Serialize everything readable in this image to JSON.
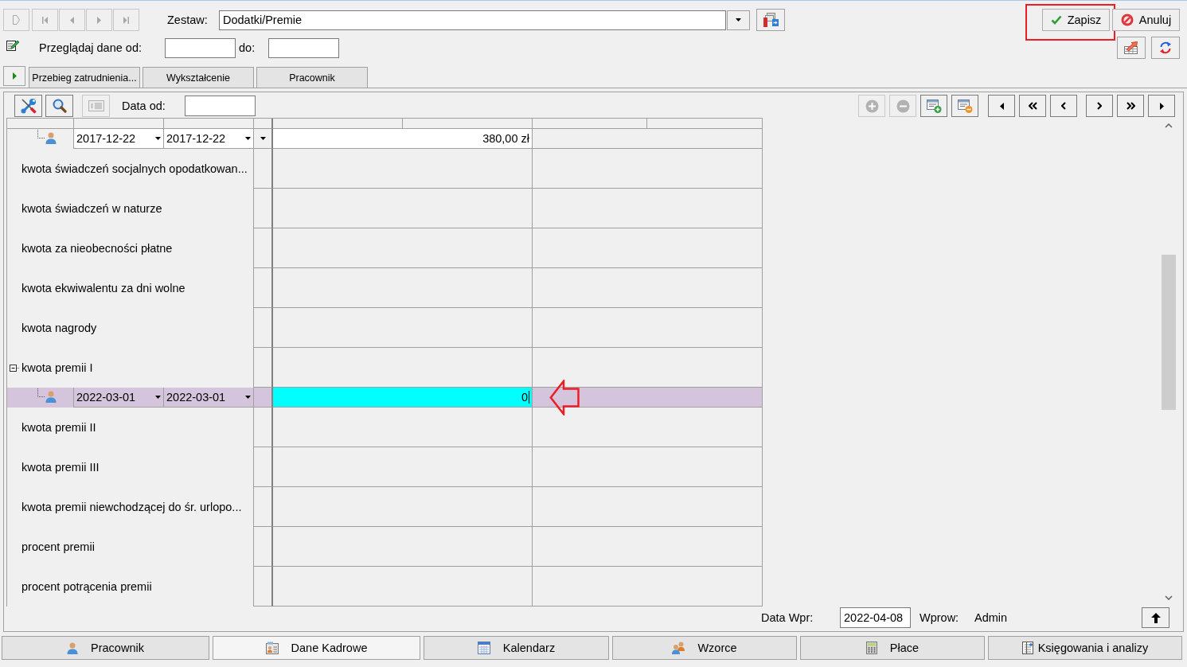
{
  "record_nav": [
    {
      "kind": "new",
      "disabled": true
    },
    {
      "kind": "first",
      "disabled": true
    },
    {
      "kind": "previous",
      "disabled": true
    },
    {
      "kind": "next",
      "disabled": true
    },
    {
      "kind": "last",
      "disabled": true
    }
  ],
  "set": {
    "label": "Zestaw:",
    "value": "Dodatki/Premie"
  },
  "actions": [
    {
      "kind": "save",
      "label": "Zapisz",
      "highlighted": true
    },
    {
      "kind": "cancel",
      "label": "Anuluj",
      "highlighted": false
    }
  ],
  "range": {
    "from_label": "Przeglądaj dane od:",
    "to_label": "do:"
  },
  "tabs": [
    {
      "label": "Przebieg zatrudnienia...",
      "selected": false
    },
    {
      "label": "Wykształcenie",
      "selected": false
    },
    {
      "label": "Pracownik",
      "selected": false
    }
  ],
  "grid_toolbar": {
    "tools": [
      {
        "kind": "settings",
        "disabled": false
      },
      {
        "kind": "search",
        "disabled": false
      },
      {
        "kind": "card",
        "disabled": true
      }
    ],
    "date_label": "Data od:",
    "row_tools": [
      {
        "kind": "add",
        "disabled": true
      },
      {
        "kind": "remove",
        "disabled": true
      },
      {
        "kind": "add-entry",
        "disabled": false
      },
      {
        "kind": "remove-entry",
        "disabled": false
      }
    ],
    "nav": [
      {
        "kind": "first",
        "disabled": false
      },
      {
        "kind": "page-back",
        "disabled": false
      },
      {
        "kind": "back",
        "disabled": false
      },
      {
        "kind": "forward",
        "disabled": false
      },
      {
        "kind": "page-forward",
        "disabled": false
      },
      {
        "kind": "last",
        "disabled": false
      }
    ]
  },
  "grid": {
    "rows": [
      {
        "kind": "entry",
        "date_from": "2017-12-22",
        "date_to": "2017-12-22",
        "value": "380,00 zł",
        "selected": false,
        "editing": false,
        "highlighted": false
      },
      {
        "kind": "item",
        "label": "kwota świadczeń socjalnych opodatkowan...",
        "selected": false
      },
      {
        "kind": "item",
        "label": "kwota świadczeń w naturze",
        "selected": false
      },
      {
        "kind": "item",
        "label": "kwota za nieobecności płatne",
        "selected": false
      },
      {
        "kind": "item",
        "label": "kwota ekwiwalentu za dni wolne",
        "selected": false
      },
      {
        "kind": "item",
        "label": "kwota nagrody",
        "selected": false
      },
      {
        "kind": "item",
        "label": "kwota premii I",
        "selected": false,
        "expanded": true,
        "children": [
          {
            "kind": "entry",
            "date_from": "2022-03-01",
            "date_to": "2022-03-01",
            "value": "0",
            "selected": true,
            "editing": true,
            "highlighted": true
          }
        ]
      },
      {
        "kind": "item",
        "label": "kwota premii II",
        "selected": false
      },
      {
        "kind": "item",
        "label": "kwota premii III",
        "selected": false
      },
      {
        "kind": "item",
        "label": "kwota premii niewchodzącej do śr. urlopo...",
        "selected": false
      },
      {
        "kind": "item",
        "label": "procent premii",
        "selected": false
      },
      {
        "kind": "item",
        "label": "procent potrącenia premii",
        "selected": false
      }
    ]
  },
  "footer": {
    "date_label": "Data Wpr:",
    "date": "2022-04-08",
    "user_label": "Wprow:",
    "user": "Admin"
  },
  "modules": [
    {
      "kind": "person",
      "label": "Pracownik",
      "selected": false
    },
    {
      "kind": "id-card",
      "label": "Dane Kadrowe",
      "selected": true
    },
    {
      "kind": "calendar",
      "label": "Kalendarz",
      "selected": false
    },
    {
      "kind": "people",
      "label": "Wzorce",
      "selected": false
    },
    {
      "kind": "calculator",
      "label": "Płace",
      "selected": false
    },
    {
      "kind": "ledger",
      "label": "Księgowania i analizy",
      "selected": false
    }
  ]
}
